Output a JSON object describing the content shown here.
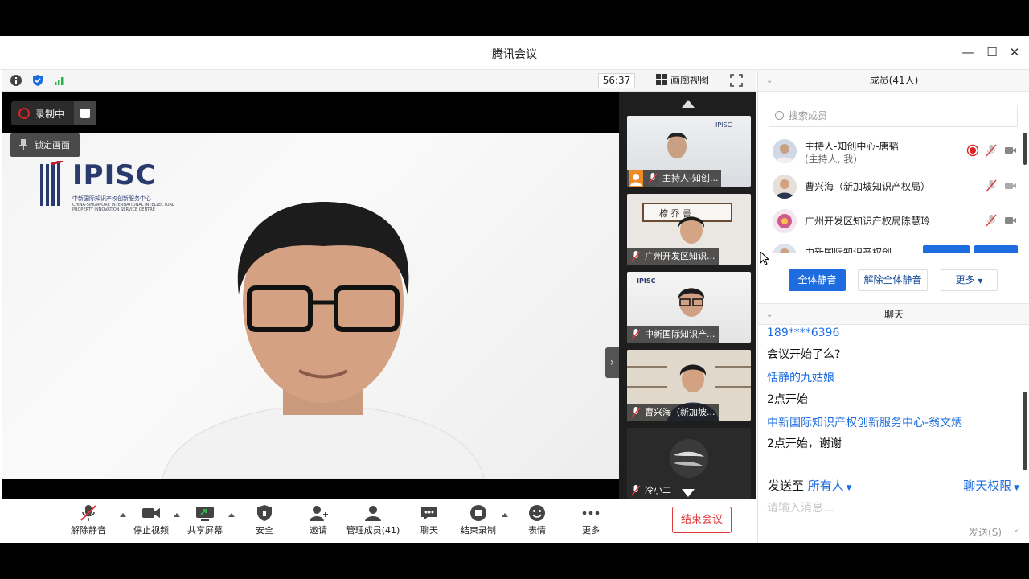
{
  "window": {
    "title": "腾讯会议"
  },
  "topbar": {
    "timer": "56:37",
    "gallery_label": "画廊视图"
  },
  "stage": {
    "recording_label": "录制中",
    "lock_label": "锁定画面",
    "logo": {
      "name": "IPISC",
      "cn": "中新国际知识产权创新服务中心",
      "en": "CHINA-SINGAPORE INTERNATIONAL INTELLECTUAL PROPERTY INNOVATION SERVICE CENTRE"
    }
  },
  "thumbnails": [
    {
      "label": "主持人-知创..."
    },
    {
      "label": "广州开发区知识..."
    },
    {
      "label": "中新国际知识产..."
    },
    {
      "label": "曹兴海（新加坡..."
    },
    {
      "label": "冷小二"
    }
  ],
  "toolbar": {
    "unmute": "解除静音",
    "stop_video": "停止视频",
    "share_screen": "共享屏幕",
    "security": "安全",
    "invite": "邀请",
    "manage_members": "管理成员(41)",
    "chat": "聊天",
    "end_recording": "结束录制",
    "reactions": "表情",
    "more": "更多",
    "end_meeting": "结束会议"
  },
  "members": {
    "header": "成员(41人)",
    "search_placeholder": "搜索成员",
    "list": [
      {
        "name": "主持人-知创中心-唐韬",
        "role": "(主持人, 我)"
      },
      {
        "name": "曹兴海（新加坡知识产权局）"
      },
      {
        "name": "广州开发区知识产权局陈慧玲"
      },
      {
        "name": "中新国际知识产权创"
      }
    ],
    "mute_all": "全体静音",
    "unmute_all": "解除全体静音",
    "more": "更多"
  },
  "chat": {
    "header": "聊天",
    "messages": [
      {
        "sender": "189****6396",
        "text": "会议开始了么?"
      },
      {
        "sender": "恬静的九姑娘",
        "text": "2点开始"
      },
      {
        "sender": "中新国际知识产权创新服务中心-翁文炳",
        "text": "2点开始，谢谢"
      }
    ],
    "send_to_label": "发送至",
    "send_to_value": "所有人",
    "permission": "聊天权限",
    "input_placeholder": "请输入消息...",
    "send_button": "发送(S)"
  },
  "colors": {
    "accent": "#1d6de0",
    "danger": "#e23a3a",
    "stage_bg": "#000000"
  }
}
